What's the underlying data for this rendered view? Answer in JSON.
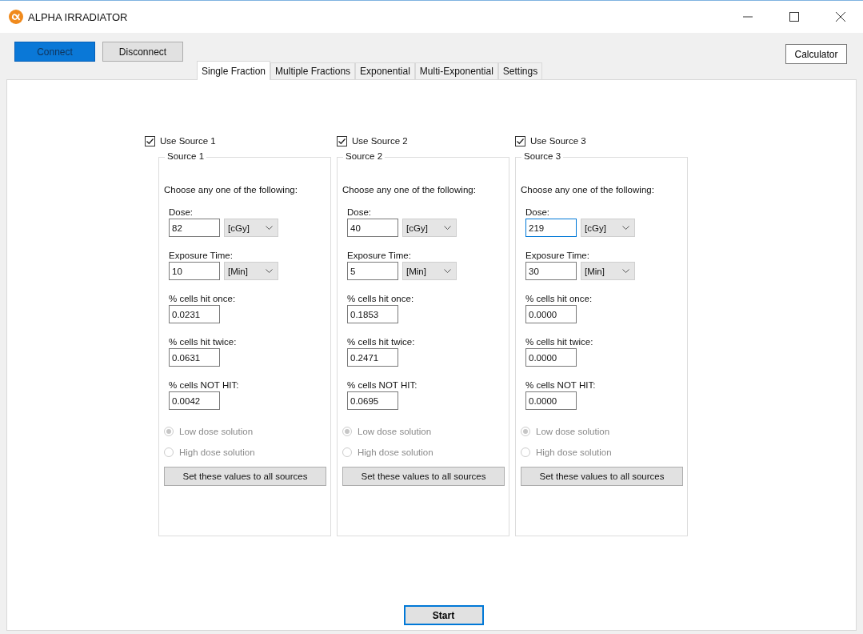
{
  "window": {
    "title": "ALPHA IRRADIATOR"
  },
  "connection_buttons": [
    {
      "label": "Connect",
      "selected": true
    },
    {
      "label": "Disconnect",
      "selected": false
    }
  ],
  "tabs": [
    {
      "label": "Single Fraction",
      "selected": true
    },
    {
      "label": "Multiple Fractions",
      "selected": false
    },
    {
      "label": "Exponential",
      "selected": false
    },
    {
      "label": "Multi-Exponential",
      "selected": false
    },
    {
      "label": "Settings",
      "selected": false
    }
  ],
  "calculator_button": "Calculator",
  "sources": [
    {
      "use_label": "Use Source 1",
      "checked": true,
      "group_title": "Source 1",
      "instruction": "Choose any one of the following:",
      "inputs": [
        {
          "label": "Dose:",
          "value": "82",
          "unit": "[cGy]",
          "focused": false
        },
        {
          "label": "Exposure Time:",
          "value": "10",
          "unit": "[Min]",
          "focused": false
        }
      ],
      "outputs": [
        {
          "label": "% cells hit once:",
          "value": "0.0231"
        },
        {
          "label": "% cells hit twice:",
          "value": "0.0631"
        },
        {
          "label": "% cells NOT HIT:",
          "value": "0.0042"
        }
      ],
      "options": [
        {
          "label": "Low dose solution",
          "selected": true,
          "disabled": true
        },
        {
          "label": "High dose solution",
          "selected": false,
          "disabled": true
        }
      ],
      "apply_button": "Set these values to all sources"
    },
    {
      "use_label": "Use Source 2",
      "checked": true,
      "group_title": "Source 2",
      "instruction": "Choose any one of the following:",
      "inputs": [
        {
          "label": "Dose:",
          "value": "40",
          "unit": "[cGy]",
          "focused": false
        },
        {
          "label": "Exposure Time:",
          "value": "5",
          "unit": "[Min]",
          "focused": false
        }
      ],
      "outputs": [
        {
          "label": "% cells hit once:",
          "value": "0.1853"
        },
        {
          "label": "% cells hit twice:",
          "value": "0.2471"
        },
        {
          "label": "% cells NOT HIT:",
          "value": "0.0695"
        }
      ],
      "options": [
        {
          "label": "Low dose solution",
          "selected": true,
          "disabled": true
        },
        {
          "label": "High dose solution",
          "selected": false,
          "disabled": true
        }
      ],
      "apply_button": "Set these values to all sources"
    },
    {
      "use_label": "Use Source 3",
      "checked": true,
      "group_title": "Source 3",
      "instruction": "Choose any one of the following:",
      "inputs": [
        {
          "label": "Dose:",
          "value": "219",
          "unit": "[cGy]",
          "focused": true
        },
        {
          "label": "Exposure Time:",
          "value": "30",
          "unit": "[Min]",
          "focused": false
        }
      ],
      "outputs": [
        {
          "label": "% cells hit once:",
          "value": "0.0000"
        },
        {
          "label": "% cells hit twice:",
          "value": "0.0000"
        },
        {
          "label": "% cells NOT HIT:",
          "value": "0.0000"
        }
      ],
      "options": [
        {
          "label": "Low dose solution",
          "selected": true,
          "disabled": true
        },
        {
          "label": "High dose solution",
          "selected": false,
          "disabled": true
        }
      ],
      "apply_button": "Set these values to all sources"
    }
  ],
  "start_button": "Start"
}
